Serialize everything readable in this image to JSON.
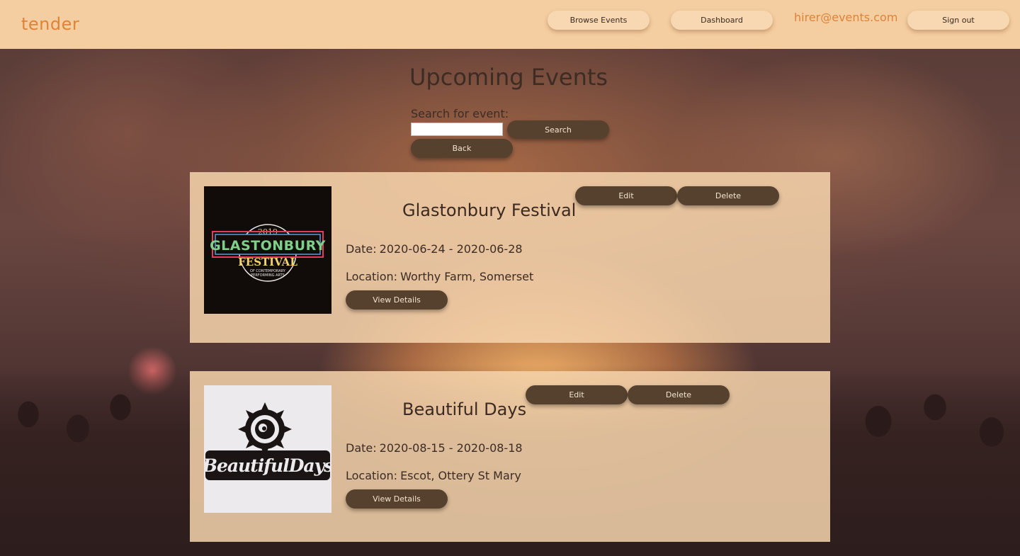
{
  "app": {
    "logo": "tender"
  },
  "header": {
    "nav": [
      {
        "label": "Browse Events"
      },
      {
        "label": "Dashboard"
      }
    ],
    "user_email": "hirer@events.com",
    "sign_out_label": "Sign out"
  },
  "main": {
    "title": "Upcoming Events",
    "search": {
      "label": "Search for event:",
      "value": "",
      "placeholder": "",
      "search_button": "Search",
      "back_button": "Back"
    },
    "events": [
      {
        "name": "Glastonbury Festival",
        "date_label": "Date:",
        "date": "2020-06-24 - 2020-06-28",
        "location_label": "Location:",
        "location": "Worthy Farm, Somerset",
        "edit_label": "Edit",
        "delete_label": "Delete",
        "details_label": "View Details",
        "logo": {
          "year": "2019",
          "word1": "GLASTONBURY",
          "word2": "FESTIVAL",
          "line3": "OF CONTEMPORARY",
          "line4": "PERFORMING ARTS"
        }
      },
      {
        "name": "Beautiful Days",
        "date_label": "Date:",
        "date": "2020-08-15 - 2020-08-18",
        "location_label": "Location:",
        "location": "Escot, Ottery St Mary",
        "edit_label": "Edit",
        "delete_label": "Delete",
        "details_label": "View Details",
        "logo": {
          "text": "BeautifulDays"
        }
      }
    ]
  },
  "colors": {
    "header_bg": "#f4cda0",
    "accent": "#dc8438",
    "button_dark": "#56412e",
    "button_light": "#f7d8b2",
    "card_bg": "#f6d4ac"
  }
}
